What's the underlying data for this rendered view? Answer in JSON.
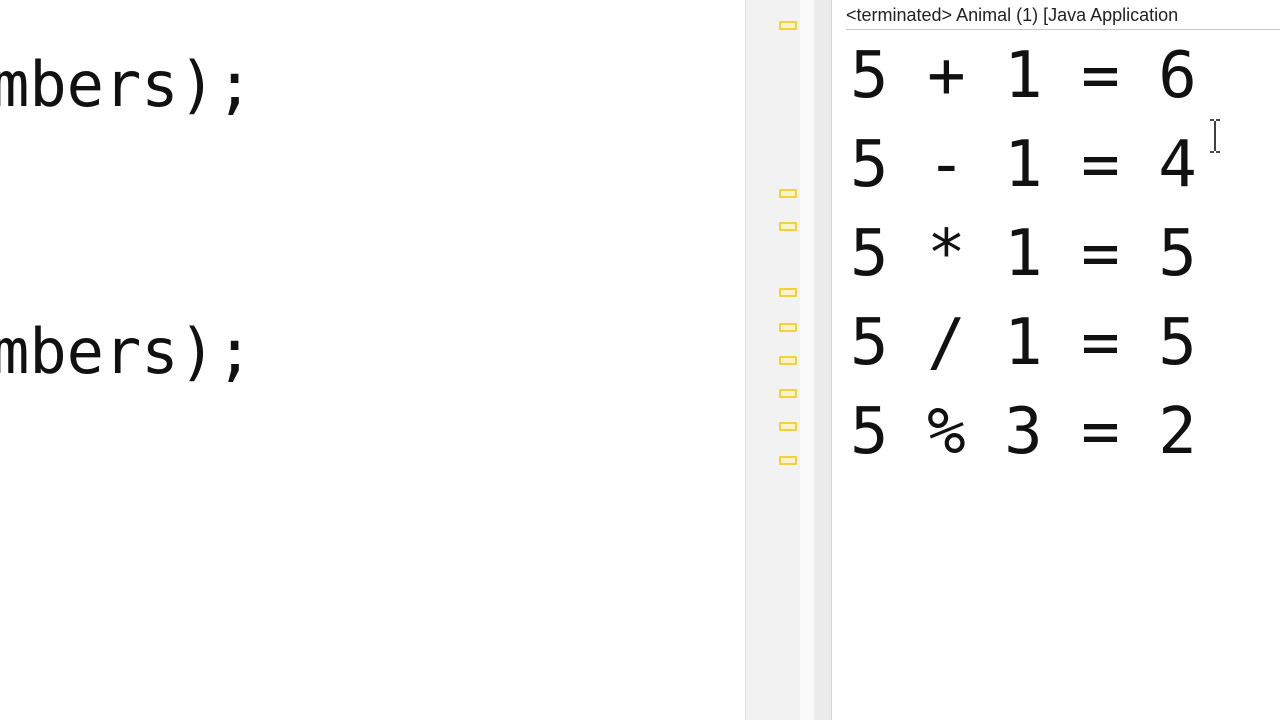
{
  "editor": {
    "lines": [
      "mbers);",
      "mbers);"
    ]
  },
  "console": {
    "header": "<terminated> Animal (1) [Java Application",
    "output": [
      "5 + 1 = 6",
      "5 - 1 = 4",
      "5 * 1 = 5",
      "5 / 1 = 5",
      "5 % 3 = 2"
    ]
  },
  "icons": {
    "ruler_marker": "warning-annotation-marker",
    "cursor": "text-cursor-icon"
  },
  "colors": {
    "ruler_marker_border": "#f2d13a",
    "ruler_marker_fill": "#fbf4c8",
    "text": "#111111"
  }
}
